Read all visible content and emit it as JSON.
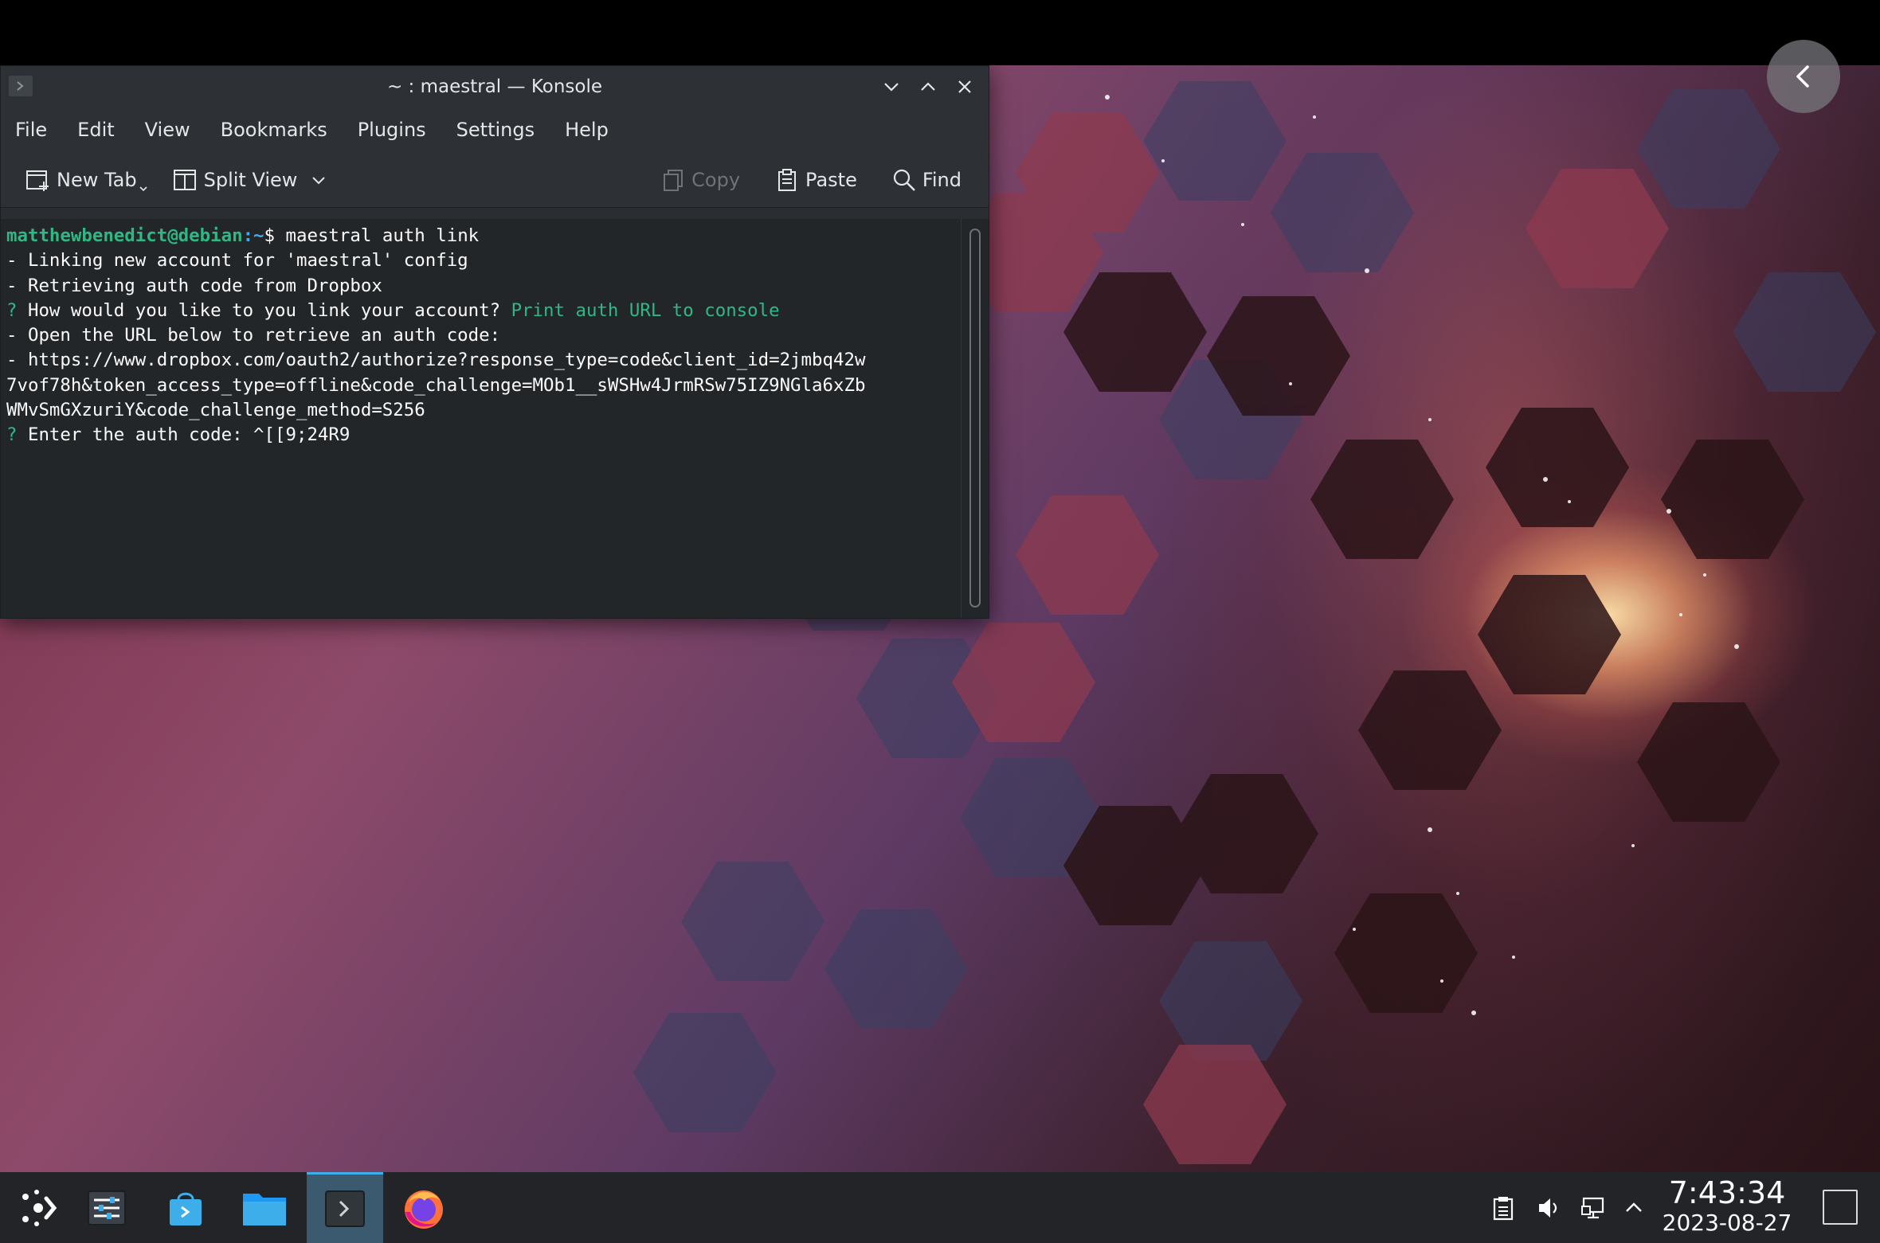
{
  "window": {
    "title": "~ : maestral — Konsole",
    "menu": [
      "File",
      "Edit",
      "View",
      "Bookmarks",
      "Plugins",
      "Settings",
      "Help"
    ],
    "toolbar": {
      "new_tab": "New Tab",
      "split_view": "Split View",
      "copy": "Copy",
      "paste": "Paste",
      "find": "Find"
    }
  },
  "terminal": {
    "prompt_user": "matthewbenedict@debian",
    "prompt_path": ":~",
    "prompt_symbol": "$ ",
    "command": "maestral auth link",
    "line1": "- Linking new account for 'maestral' config",
    "line2": "- Retrieving auth code from Dropbox",
    "line3_q": "? ",
    "line3_text": "How would you like to you link your account? ",
    "line3_answer": "Print auth URL to console",
    "line4": "- Open the URL below to retrieve an auth code:",
    "line5": "- https://www.dropbox.com/oauth2/authorize?response_type=code&client_id=2jmbq42w",
    "line6": "7vof78h&token_access_type=offline&code_challenge=MOb1__sWSHw4JrmRSw75IZ9NGla6xZb",
    "line7": "WMvSmGXzuriY&code_challenge_method=S256",
    "line8_q": "? ",
    "line8_text": "Enter the auth code: ^[[9;24R9"
  },
  "taskbar": {
    "apps": [
      "application-launcher-icon",
      "system-settings-icon",
      "discover-store-icon",
      "file-manager-icon",
      "konsole-icon",
      "firefox-icon"
    ],
    "active_app": "konsole-icon",
    "tray": [
      "clipboard-icon",
      "volume-icon",
      "network-icon",
      "chevron-up-icon"
    ],
    "time": "7:43:34",
    "date": "2023-08-27"
  },
  "colors": {
    "terminal_bg": "#232629",
    "prompt_green": "#2fb884",
    "prompt_blue": "#3daee9",
    "taskbar_bg": "#222428"
  }
}
